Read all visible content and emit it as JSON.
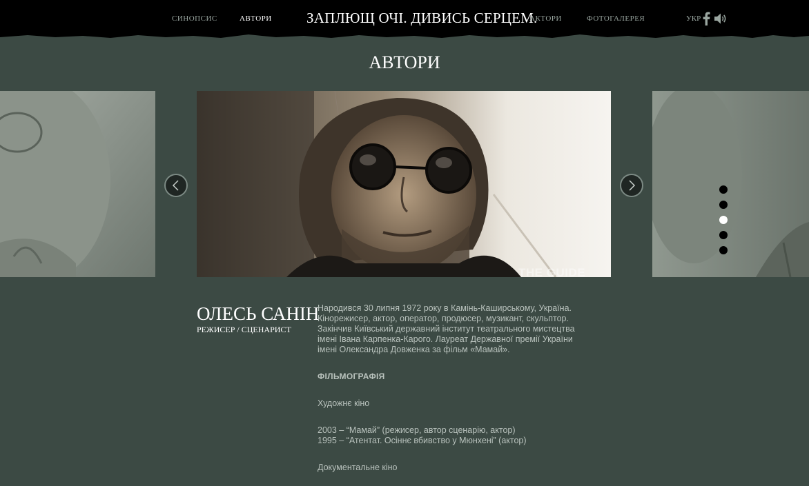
{
  "nav": {
    "items": [
      {
        "label": "СИНОПСИС"
      },
      {
        "label": "АВТОРИ"
      },
      {
        "label": "АКТОРИ"
      },
      {
        "label": "ФОТОГАЛЕРЕЯ"
      }
    ],
    "active": "АВТОРИ",
    "site_title": "ЗАПЛЮЩ ОЧІ. ДИВИСЬ СЕРЦЕМ.",
    "language": "УКР",
    "icons": [
      "facebook-icon",
      "sound-icon"
    ]
  },
  "page": {
    "section_title": "АВТОРИ"
  },
  "carousel": {
    "main_image_watermark": "THE GUIDE",
    "dots_count": 5,
    "active_dot": 3,
    "prev_icon": "chevron-left-icon",
    "next_icon": "chevron-right-icon"
  },
  "person": {
    "name": "ОЛЕСЬ САНІН",
    "role": "РЕЖИСЕР / СЦЕНАРИСТ",
    "bio_lines": [
      "Народився 30 липня 1972 року в Камінь-Каширському, Україна.",
      "Кінорежисер, актор, оператор, продюсер, музикант, скульптор.",
      "Закінчив Київський державний інститут театрального мистецтва",
      "імені Івана Карпенка-Карого. Лауреат Державної премії України",
      "імені Олександра Довженка за фільм «Мамай»."
    ],
    "filmography_heading": "ФІЛЬМОГРАФІЯ",
    "feature_heading": "Художнє кіно",
    "films": [
      "2003 – “Мамай” (режисер, автор сценарію, актор)",
      "1995 – “Атентат. Осіннє вбивство у Мюнхені” (актор)"
    ],
    "documentary_heading": "Документальне кіно"
  },
  "colors": {
    "background": "#3c4a44",
    "topbar": "#000000",
    "nav_text": "#9aa6a0",
    "active_text": "#ffffff",
    "body_text": "#b9c2bd"
  }
}
